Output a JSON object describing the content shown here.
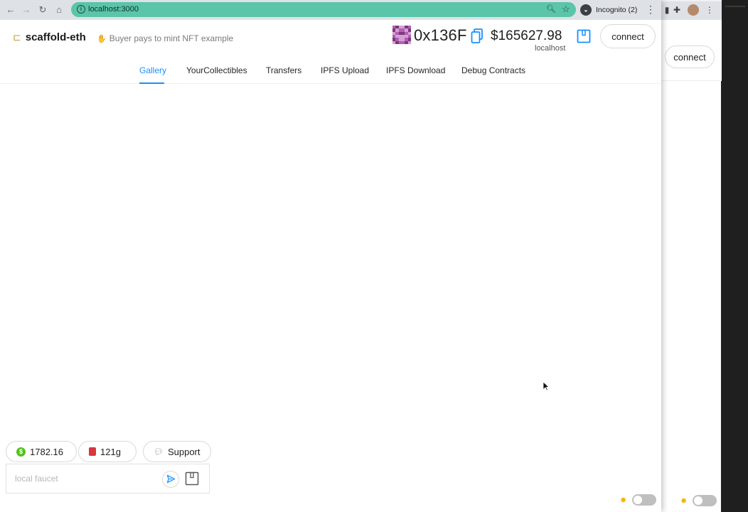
{
  "browser": {
    "url": "localhost:3000",
    "incognito_label": "Incognito (2)"
  },
  "header": {
    "title": "scaffold-eth",
    "subtitle": "Buyer pays to mint NFT example"
  },
  "account": {
    "address": "0x136F",
    "balance": "$165627.98",
    "network": "localhost",
    "connect_label": "connect"
  },
  "tabs": [
    {
      "label": "Gallery",
      "active": true
    },
    {
      "label": "YourCollectibles",
      "active": false
    },
    {
      "label": "Transfers",
      "active": false
    },
    {
      "label": "IPFS Upload",
      "active": false
    },
    {
      "label": "IPFS Download",
      "active": false
    },
    {
      "label": "Debug Contracts",
      "active": false
    }
  ],
  "footer": {
    "eth_price": "1782.16",
    "gas_price": "121g",
    "support_label": "Support",
    "faucet_placeholder": "local faucet"
  },
  "background_window": {
    "connect_label": "connect"
  },
  "colors": {
    "accent": "#1890ff",
    "omnibox": "#5ac5a9",
    "blockie": "#7a3a7a"
  }
}
